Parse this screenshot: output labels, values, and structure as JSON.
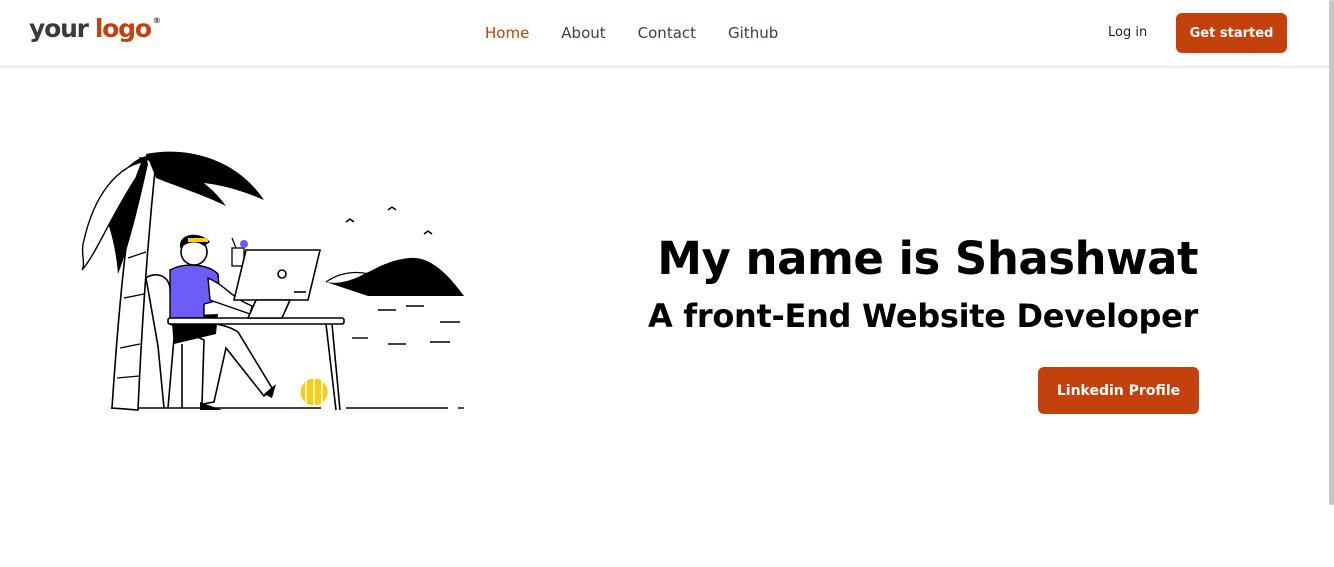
{
  "header": {
    "logo": {
      "word1": "your",
      "word2": "logo",
      "mark": "®"
    },
    "nav": [
      {
        "label": "Home",
        "active": true
      },
      {
        "label": "About",
        "active": false
      },
      {
        "label": "Contact",
        "active": false
      },
      {
        "label": "Github",
        "active": false
      }
    ],
    "login_label": "Log in",
    "cta_label": "Get started"
  },
  "hero": {
    "title": "My name is Shashwat",
    "subtitle": "A front-End Website Developer",
    "button_label": "Linkedin Profile",
    "illustration": "person-working-on-laptop-at-beach"
  },
  "colors": {
    "accent": "#c2410c",
    "text": "#000000",
    "nav_text": "#374151",
    "shirt": "#6d5cf5",
    "ball": "#facc15"
  }
}
